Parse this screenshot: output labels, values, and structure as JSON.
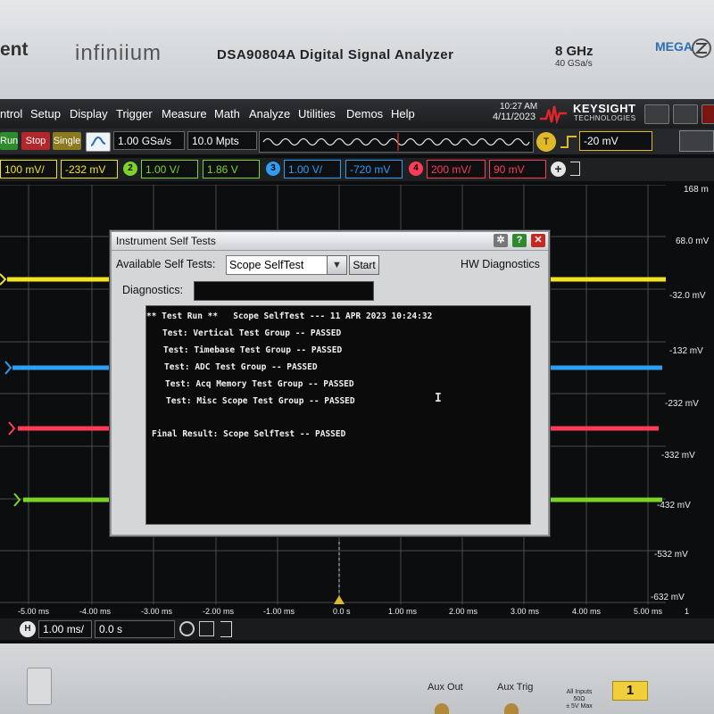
{
  "bezel": {
    "brand_fragment": "ent",
    "logo": "infiniium",
    "model": "DSA90804A  Digital Signal Analyzer",
    "bandwidth": "8 GHz",
    "sample_rate_rating": "40 GSa/s",
    "badge": "MEGA",
    "aux_out": "Aux Out",
    "aux_trig": "Aux Trig",
    "inputs_note": [
      "All Inputs",
      "50Ω",
      "± 5V Max"
    ],
    "channel_number": "1"
  },
  "menu": {
    "items": [
      "ntrol",
      "Setup",
      "Display",
      "Trigger",
      "Measure",
      "Math",
      "Analyze",
      "Utilities",
      "Demos",
      "Help"
    ],
    "time": "10:27 AM",
    "date": "4/11/2023",
    "vendor": "KEYSIGHT",
    "vendor_sub": "TECHNOLOGIES"
  },
  "toolbar": {
    "run": "Run",
    "stop": "Stop",
    "single": "Single",
    "sample_rate": "1.00 GSa/s",
    "memory_depth": "10.0 Mpts",
    "trigger_badge": "T",
    "trigger_level": "-20 mV"
  },
  "channels": {
    "ch1_scale": "100 mV/",
    "ch1_offset": "-232 mV",
    "ch2_num": "2",
    "ch2_scale": "1.00 V/",
    "ch2_offset": "1.86 V",
    "ch3_num": "3",
    "ch3_scale": "1.00 V/",
    "ch3_offset": "-720 mV",
    "ch4_num": "4",
    "ch4_scale": "200 mV/",
    "ch4_offset": "90 mV"
  },
  "vertical_scale": [
    "168 m",
    "68.0 mV",
    "-32.0 mV",
    "-132 mV",
    "-232 mV",
    "-332 mV",
    "-432 mV",
    "-532 mV",
    "-632 mV"
  ],
  "time_axis": [
    "-5.00 ms",
    "-4.00 ms",
    "-3.00 ms",
    "-2.00 ms",
    "-1.00 ms",
    "0.0 s",
    "1.00 ms",
    "2.00 ms",
    "3.00 ms",
    "4.00 ms",
    "5.00 ms",
    "1"
  ],
  "timebase": {
    "h_badge": "H",
    "scale": "1.00 ms/",
    "position": "0.0 s"
  },
  "colors": {
    "ch1": "#f2e322",
    "ch2": "#7cd42a",
    "ch3": "#2f9df2",
    "ch4": "#ff3b5a",
    "grid": "#4a4c4e",
    "dialog_bg": "#d4d6d8"
  },
  "dialog": {
    "title": "Instrument Self Tests",
    "available_label": "Available Self Tests:",
    "selected_test": "Scope SelfTest",
    "start_button": "Start",
    "hw_diagnostics": "HW Diagnostics",
    "diagnostics_label": "Diagnostics:",
    "results": [
      "** Test Run **   Scope SelfTest --- 11 APR 2023 10:24:32",
      "Test: Vertical Test Group -- PASSED",
      "Test: Timebase Test Group -- PASSED",
      "Test: ADC Test Group -- PASSED",
      "Test: Acq Memory Test Group -- PASSED",
      "Test: Misc Scope Test Group -- PASSED",
      "Final Result: Scope SelfTest -- PASSED"
    ]
  }
}
